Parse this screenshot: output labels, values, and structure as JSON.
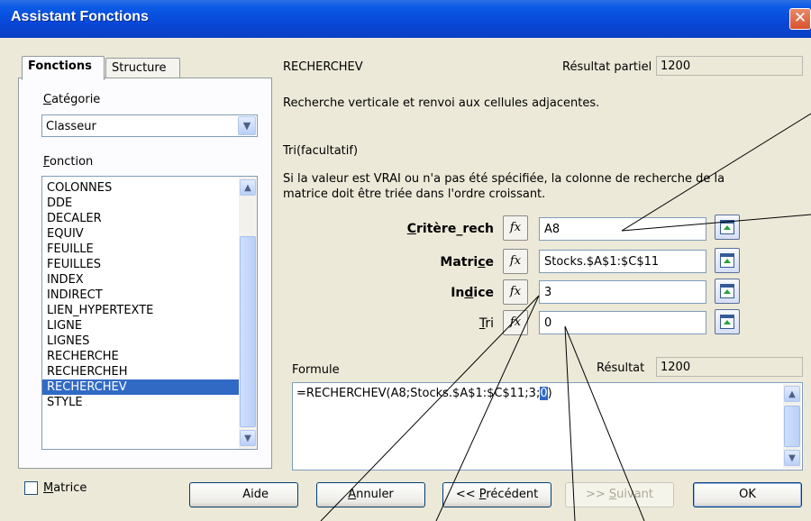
{
  "window": {
    "title": "Assistant Fonctions",
    "close_icon": "✕"
  },
  "tabs": [
    {
      "label": "Fonctions",
      "active": true
    },
    {
      "label": "Structure",
      "active": false
    }
  ],
  "category": {
    "label_ul": "C",
    "label_rest": "atégorie",
    "value": "Classeur"
  },
  "functions": {
    "label_ul": "F",
    "label_rest": "onction",
    "items": [
      "COLONNES",
      "DDE",
      "DECALER",
      "EQUIV",
      "FEUILLE",
      "FEUILLES",
      "INDEX",
      "INDIRECT",
      "LIEN_HYPERTEXTE",
      "LIGNE",
      "LIGNES",
      "RECHERCHE",
      "RECHERCHEH",
      "RECHERCHEV",
      "STYLE"
    ],
    "selected": "RECHERCHEV"
  },
  "function_info": {
    "name": "RECHERCHEV",
    "partial_result_label": "Résultat partiel",
    "partial_result_value": "1200",
    "description": "Recherche verticale et renvoi aux cellules adjacentes.",
    "arg_title": "Tri(facultatif)",
    "arg_help_line1": "Si la valeur est VRAI ou n'a pas été spécifiée, la colonne de recherche de la",
    "arg_help_line2": "matrice doit être triée dans l'ordre croissant."
  },
  "arguments": [
    {
      "pre": "",
      "ul": "C",
      "post": "ritère_rech",
      "value": "A8"
    },
    {
      "pre": "Matri",
      "ul": "c",
      "post": "e",
      "value": "Stocks.$A$1:$C$11"
    },
    {
      "pre": "In",
      "ul": "d",
      "post": "ice",
      "value": "3"
    },
    {
      "pre": "",
      "ul": "T",
      "post": "ri",
      "value": "0"
    }
  ],
  "fx_label": "fx",
  "result": {
    "label": "Résultat",
    "value": "1200"
  },
  "formula": {
    "label": "Formule",
    "text_before": "=RECHERCHEV(A8;Stocks.$A$1:$C$11;3;",
    "text_highlight": "0",
    "text_after": ")"
  },
  "matrix_checkbox": {
    "label_ul": "M",
    "label_rest": "atrice",
    "checked": false
  },
  "buttons": {
    "help": "Aide",
    "cancel_pre": "",
    "cancel_ul": "A",
    "cancel_post": "nnuler",
    "prev_pre": "<< ",
    "prev_ul": "P",
    "prev_post": "récédent",
    "next_pre": ">> ",
    "next_ul": "S",
    "next_post": "uivant",
    "ok": "OK"
  }
}
